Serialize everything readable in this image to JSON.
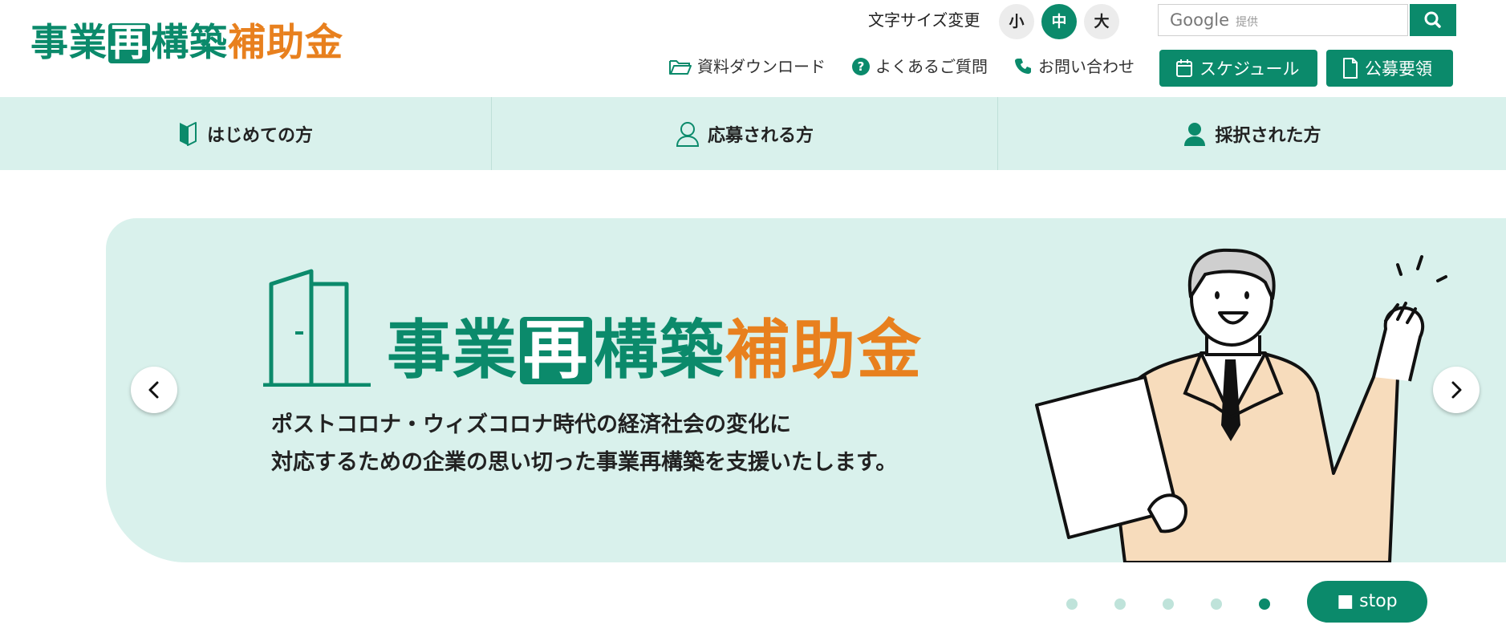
{
  "header": {
    "logo": {
      "part1": "事業",
      "part2": "再",
      "part3": "構築",
      "part4": "補助金"
    },
    "font_size": {
      "label": "文字サイズ変更",
      "options": [
        "小",
        "中",
        "大"
      ],
      "selected": "中"
    },
    "search": {
      "placeholder_brand": "Google",
      "placeholder_note": "提供"
    },
    "links": {
      "download": "資料ダウンロード",
      "faq": "よくあるご質問",
      "contact": "お問い合わせ"
    },
    "buttons": {
      "schedule": "スケジュール",
      "guidelines": "公募要領"
    }
  },
  "nav": {
    "items": [
      {
        "label": "はじめての方",
        "icon": "beginner-mark-icon"
      },
      {
        "label": "応募される方",
        "icon": "person-outline-icon"
      },
      {
        "label": "採択された方",
        "icon": "person-filled-icon"
      }
    ]
  },
  "hero": {
    "title": {
      "part1": "事業",
      "part2": "再",
      "part3": "構築",
      "part4": "補助金"
    },
    "subtitle_line1": "ポストコロナ・ウィズコロナ時代の経済社会の変化に",
    "subtitle_line2": "対応するための企業の思い切った事業再構築を支援いたします。"
  },
  "carousel": {
    "slide_count": 5,
    "active_index": 5,
    "stop_label": "■ stop"
  },
  "colors": {
    "brand_green": "#0b8a6b",
    "brand_orange": "#e8801e",
    "light_mint": "#d9f1ec"
  }
}
